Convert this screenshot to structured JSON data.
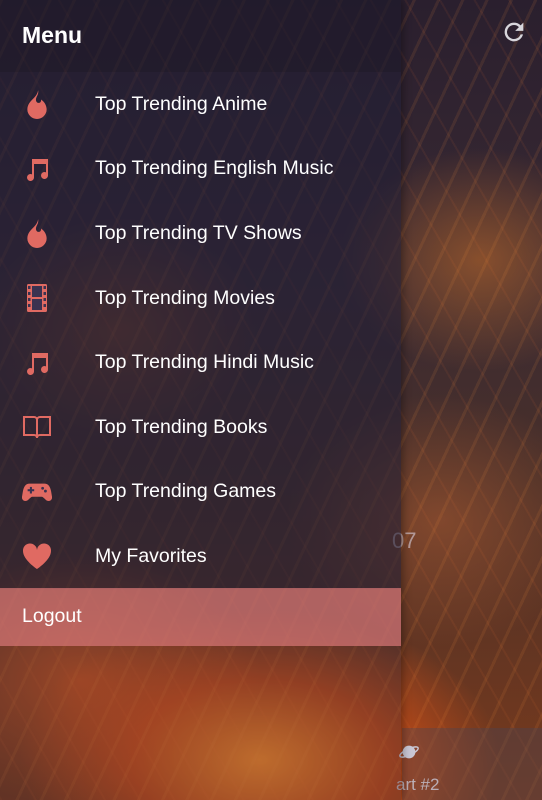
{
  "header": {
    "title": "Menu"
  },
  "menu": {
    "items": [
      {
        "label": "Top Trending Anime",
        "icon": "fire-icon"
      },
      {
        "label": "Top Trending English Music",
        "icon": "music-note-icon"
      },
      {
        "label": "Top Trending TV Shows",
        "icon": "fire-icon"
      },
      {
        "label": "Top Trending Movies",
        "icon": "film-icon"
      },
      {
        "label": "Top Trending Hindi Music",
        "icon": "music-note-icon"
      },
      {
        "label": "Top Trending Books",
        "icon": "book-icon"
      },
      {
        "label": "Top Trending Games",
        "icon": "gamepad-icon"
      },
      {
        "label": "My Favorites",
        "icon": "heart-icon"
      }
    ],
    "logout_label": "Logout"
  },
  "behind": {
    "number_text": "07",
    "tab_label": "art #2",
    "refresh_icon": "refresh-icon"
  },
  "colors": {
    "icon_accent": "#e06a62",
    "logout_bg": "#d67676",
    "text": "#ffffff"
  }
}
